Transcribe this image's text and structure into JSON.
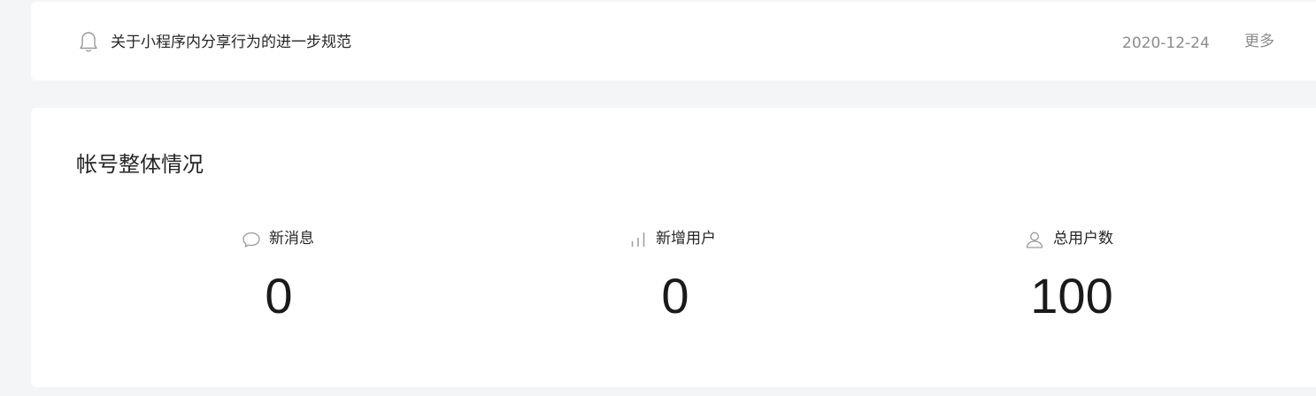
{
  "notice": {
    "icon": "bell-icon",
    "title": "关于小程序内分享行为的进一步规范",
    "date": "2020-12-24",
    "more_label": "更多"
  },
  "overview": {
    "title": "帐号整体情况",
    "stats": [
      {
        "icon": "chat-bubble-icon",
        "label": "新消息",
        "value": "0"
      },
      {
        "icon": "bar-chart-icon",
        "label": "新增用户",
        "value": "0"
      },
      {
        "icon": "user-icon",
        "label": "总用户数",
        "value": "100"
      }
    ]
  }
}
